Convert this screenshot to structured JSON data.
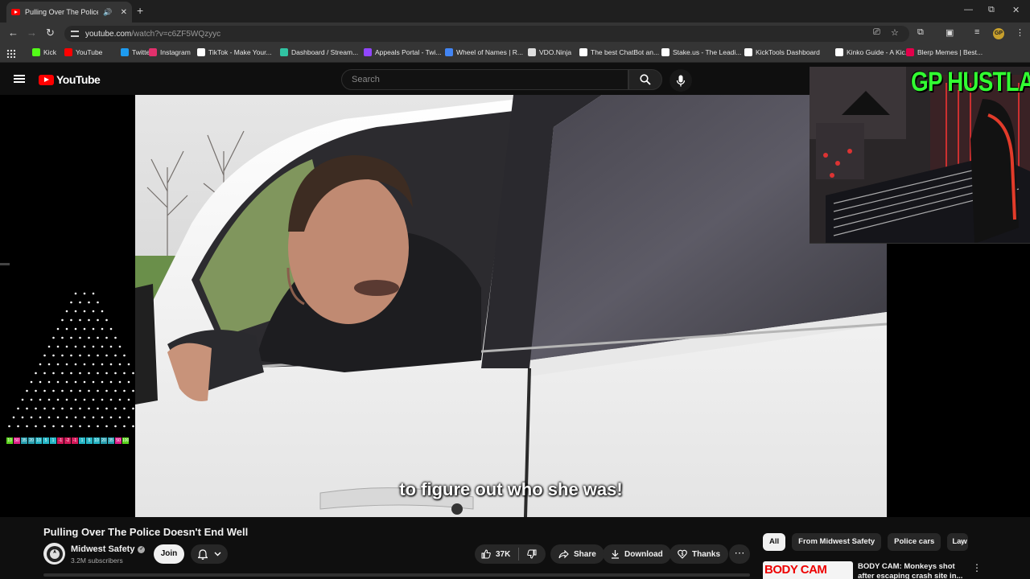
{
  "browser": {
    "tab": {
      "title": "Pulling Over The Police Doe",
      "close": "✕"
    },
    "new_tab": "+",
    "window_controls": {
      "minimize": "—",
      "restore": "⧉",
      "close": "✕"
    },
    "url": {
      "host": "youtube.com",
      "path": "/watch?v=c6ZF5WQzyyc"
    },
    "profile_initials": "GP",
    "bookmarks": [
      {
        "label": "Kick",
        "icon": "kick-icon",
        "color": "#53fc18"
      },
      {
        "label": "YouTube",
        "icon": "youtube-icon",
        "color": "#ff0000"
      },
      {
        "label": "Twitter",
        "icon": "twitter-icon",
        "color": "#1d9bf0"
      },
      {
        "label": "Instagram",
        "icon": "instagram-icon",
        "color": "#e1306c"
      },
      {
        "label": "TikTok - Make Your...",
        "icon": "tiktok-icon",
        "color": "#ffffff"
      },
      {
        "label": "Dashboard / Stream...",
        "icon": "streamlabs-icon",
        "color": "#31c3a2"
      },
      {
        "label": "Appeals Portal - Twi...",
        "icon": "twitch-icon",
        "color": "#9146ff"
      },
      {
        "label": "Wheel of Names | R...",
        "icon": "wheel-icon",
        "color": "#4285f4"
      },
      {
        "label": "VDO.Ninja",
        "icon": "ninja-icon",
        "color": "#dddddd"
      },
      {
        "label": "The best ChatBot an...",
        "icon": "chatbot-icon",
        "color": "#ffffff"
      },
      {
        "label": "Stake.us - The Leadi...",
        "icon": "stake-icon",
        "color": "#ffffff"
      },
      {
        "label": "KickTools Dashboard",
        "icon": "kicktools-icon",
        "color": "#ffffff"
      },
      {
        "label": "Kinko Guide - A Kic...",
        "icon": "kinko-icon",
        "color": "#ffffff"
      },
      {
        "label": "Blerp Memes | Best...",
        "icon": "blerp-icon",
        "color": "#e4004b"
      }
    ]
  },
  "youtube": {
    "logo_text": "YouTube",
    "search_placeholder": "Search",
    "caption": "to figure out who she was!",
    "overlay_brand": "GP HUSTLA",
    "video_title": "Pulling Over The Police Doesn't End Well",
    "channel": {
      "name": "Midwest Safety",
      "subscribers": "3.2M subscribers"
    },
    "join_label": "Join",
    "likes": "37K",
    "share_label": "Share",
    "download_label": "Download",
    "thanks_label": "Thanks",
    "chips": [
      "All",
      "From Midwest Safety",
      "Police cars",
      "Law"
    ],
    "recommended": {
      "thumb_text": "BODY CAM",
      "title": "BODY CAM: Monkeys shot after escaping crash site in..."
    },
    "score_strip": [
      "10",
      "50",
      "35",
      "20",
      "10",
      "5",
      "1",
      "-1",
      "-2",
      "-1",
      "1",
      "5",
      "10",
      "20",
      "35",
      "50",
      "100"
    ],
    "colors": {
      "accent": "#ff0000",
      "overlay_text": "#32ff32"
    }
  }
}
